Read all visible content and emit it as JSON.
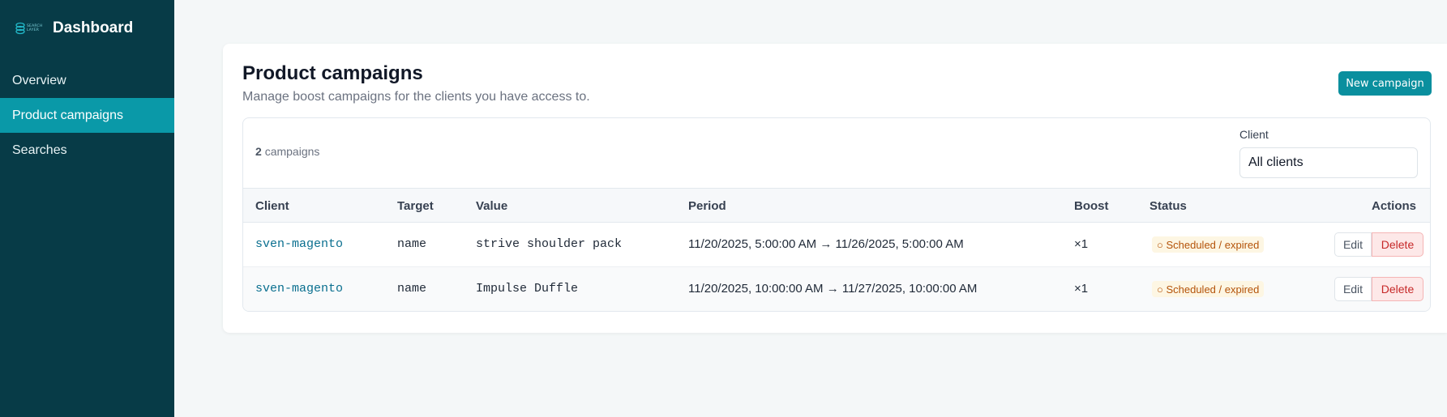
{
  "sidebar": {
    "logo_text": [
      "SEARCH",
      "LAYER"
    ],
    "title": "Dashboard",
    "items": [
      {
        "label": "Overview"
      },
      {
        "label": "Product campaigns",
        "active": true
      },
      {
        "label": "Searches"
      }
    ]
  },
  "main": {
    "title": "Product campaigns",
    "subtitle": "Manage boost campaigns for the clients you have access to.",
    "new_button": "New campaign",
    "count_number": "2",
    "count_label": "campaigns",
    "filter": {
      "label": "Client",
      "value": "All clients"
    },
    "columns": [
      "Client",
      "Target",
      "Value",
      "Period",
      "Boost",
      "Status",
      "Actions"
    ],
    "rows": [
      {
        "client": "sven-magento",
        "target": "name",
        "value": "strive shoulder pack",
        "period": "11/20/2025, 5:00:00 AM → 11/26/2025, 5:00:00 AM",
        "boost": "×1",
        "status": "○ Scheduled / expired",
        "edit": "Edit",
        "delete": "Delete"
      },
      {
        "client": "sven-magento",
        "target": "name",
        "value": "Impulse Duffle",
        "period": "11/20/2025, 10:00:00 AM → 11/27/2025, 10:00:00 AM",
        "boost": "×1",
        "status": "○ Scheduled / expired",
        "edit": "Edit",
        "delete": "Delete"
      }
    ]
  },
  "colors": {
    "sidebar_bg": "#073b47",
    "active_nav": "#0a99a8",
    "primary_button": "#0a8f9e",
    "status_warning": "#b45309",
    "danger": "#c62828"
  },
  "icons": {
    "logo": "searchlayer-logo-icon"
  }
}
